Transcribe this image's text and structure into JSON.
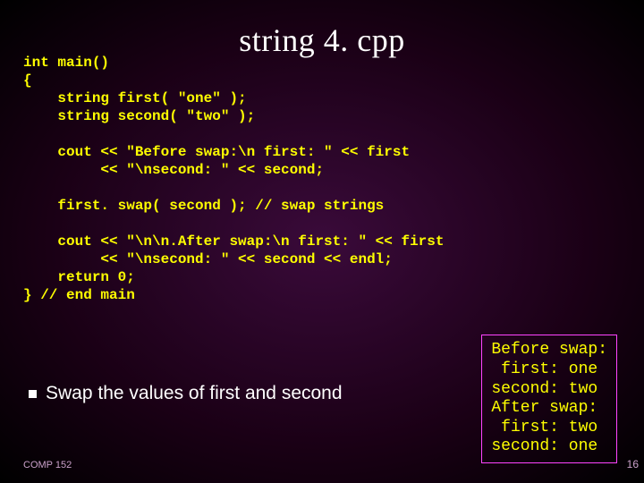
{
  "title": "string 4. cpp",
  "code": "int main()\n{\n    string first( \"one\" );\n    string second( \"two\" );\n\n    cout << \"Before swap:\\n first: \" << first\n         << \"\\nsecond: \" << second;\n\n    first. swap( second ); // swap strings\n\n    cout << \"\\n\\n.After swap:\\n first: \" << first\n         << \"\\nsecond: \" << second << endl;\n    return 0;\n} // end main",
  "bullet": "Swap the values of first and second",
  "output": "Before swap:\n first: one\nsecond: two\nAfter swap:\n first: two\nsecond: one",
  "footer": {
    "course": "COMP 152",
    "page": "16"
  }
}
